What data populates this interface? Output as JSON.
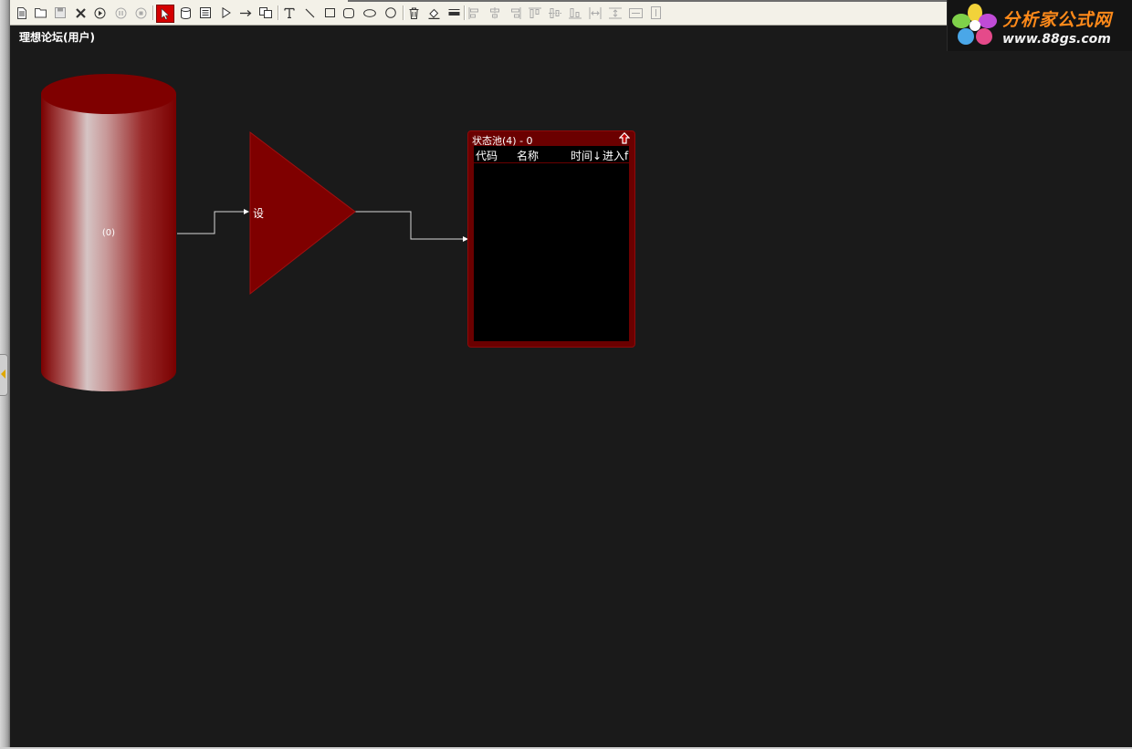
{
  "canvas": {
    "title": "理想论坛(用户)"
  },
  "logo": {
    "title": "分析家公式网",
    "url": "www.88gs.com"
  },
  "cylinder": {
    "label": "(0)"
  },
  "triangle": {
    "label": "设"
  },
  "state_pool": {
    "title": "状态池(4) - 0",
    "columns": [
      "代码",
      "名称",
      "时间↓",
      "进入f"
    ]
  },
  "colors": {
    "canvas_bg": "#1a1a1a",
    "node_red": "#7f0000",
    "toolbar_bg": "#f3f1e8",
    "active_tool": "#d40000"
  },
  "toolbar": {
    "icons": [
      "new-icon",
      "open-icon",
      "save-icon",
      "delete-icon",
      "run-icon",
      "pause-icon",
      "stop-icon",
      "select-arrow-icon",
      "database-icon",
      "list-icon",
      "play-triangle-icon",
      "arrow-right-icon",
      "copy-icon",
      "text-icon",
      "line-icon",
      "rectangle-icon",
      "rounded-rect-icon",
      "ellipse-icon",
      "circle-icon",
      "trash-icon",
      "fill-color-icon",
      "line-width-icon",
      "align-left-icon",
      "align-center-icon",
      "align-right-icon",
      "align-top-icon",
      "align-middle-icon",
      "align-bottom-icon",
      "distribute-h-icon",
      "distribute-v-icon",
      "same-width-icon",
      "same-height-icon"
    ]
  }
}
